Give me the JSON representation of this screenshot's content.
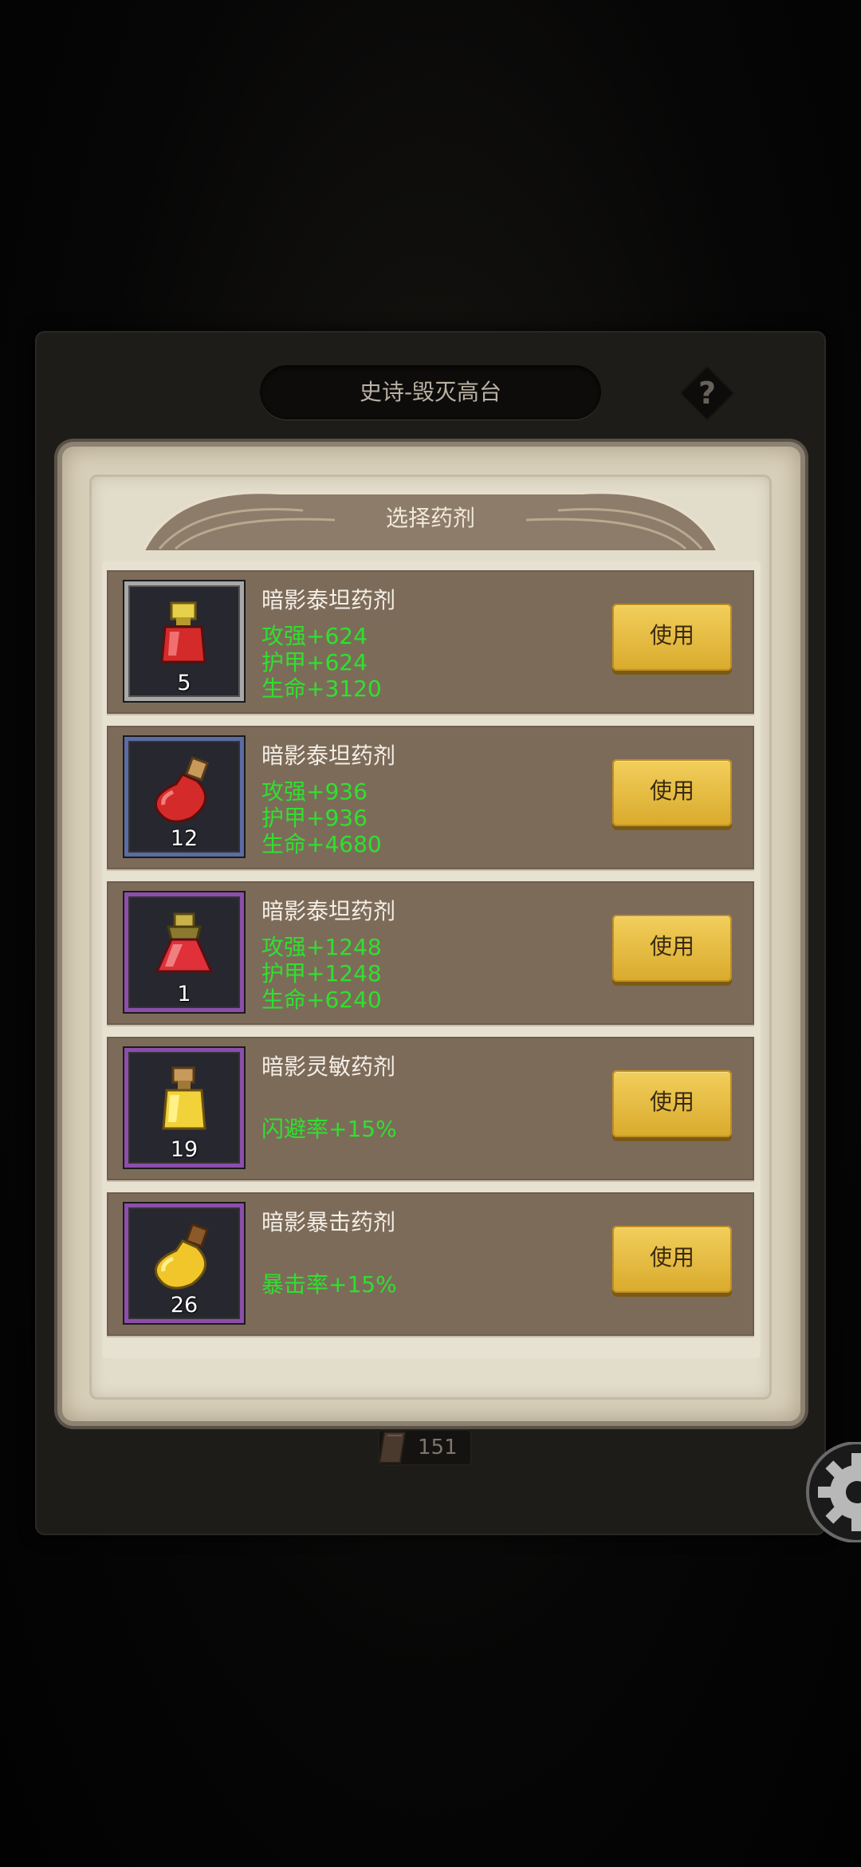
{
  "dungeon_title": "史诗-毁灭高台",
  "help_label": "?",
  "modal_title": "选择药剂",
  "use_label": "使用",
  "items": [
    {
      "name": "暗影泰坦药剂",
      "count": "5",
      "rarity": "gray",
      "icon": "red-square-potion-icon",
      "stats": [
        "攻强+624",
        "护甲+624",
        "生命+3120"
      ]
    },
    {
      "name": "暗影泰坦药剂",
      "count": "12",
      "rarity": "blue",
      "icon": "red-flask-potion-icon",
      "stats": [
        "攻强+936",
        "护甲+936",
        "生命+4680"
      ]
    },
    {
      "name": "暗影泰坦药剂",
      "count": "1",
      "rarity": "purple",
      "icon": "red-bottle-potion-icon",
      "stats": [
        "攻强+1248",
        "护甲+1248",
        "生命+6240"
      ]
    },
    {
      "name": "暗影灵敏药剂",
      "count": "19",
      "rarity": "purple",
      "icon": "yellow-square-potion-icon",
      "stats": [
        "闪避率+15%"
      ]
    },
    {
      "name": "暗影暴击药剂",
      "count": "26",
      "rarity": "purple",
      "icon": "yellow-flask-potion-icon",
      "stats": [
        "暴击率+15%"
      ]
    }
  ],
  "currency": {
    "icon": "scroll-icon",
    "value": "151"
  },
  "colors": {
    "stat_green": "#2fe02f",
    "button_gold": "#e7bd43",
    "item_bg": "#7d6b5a"
  }
}
